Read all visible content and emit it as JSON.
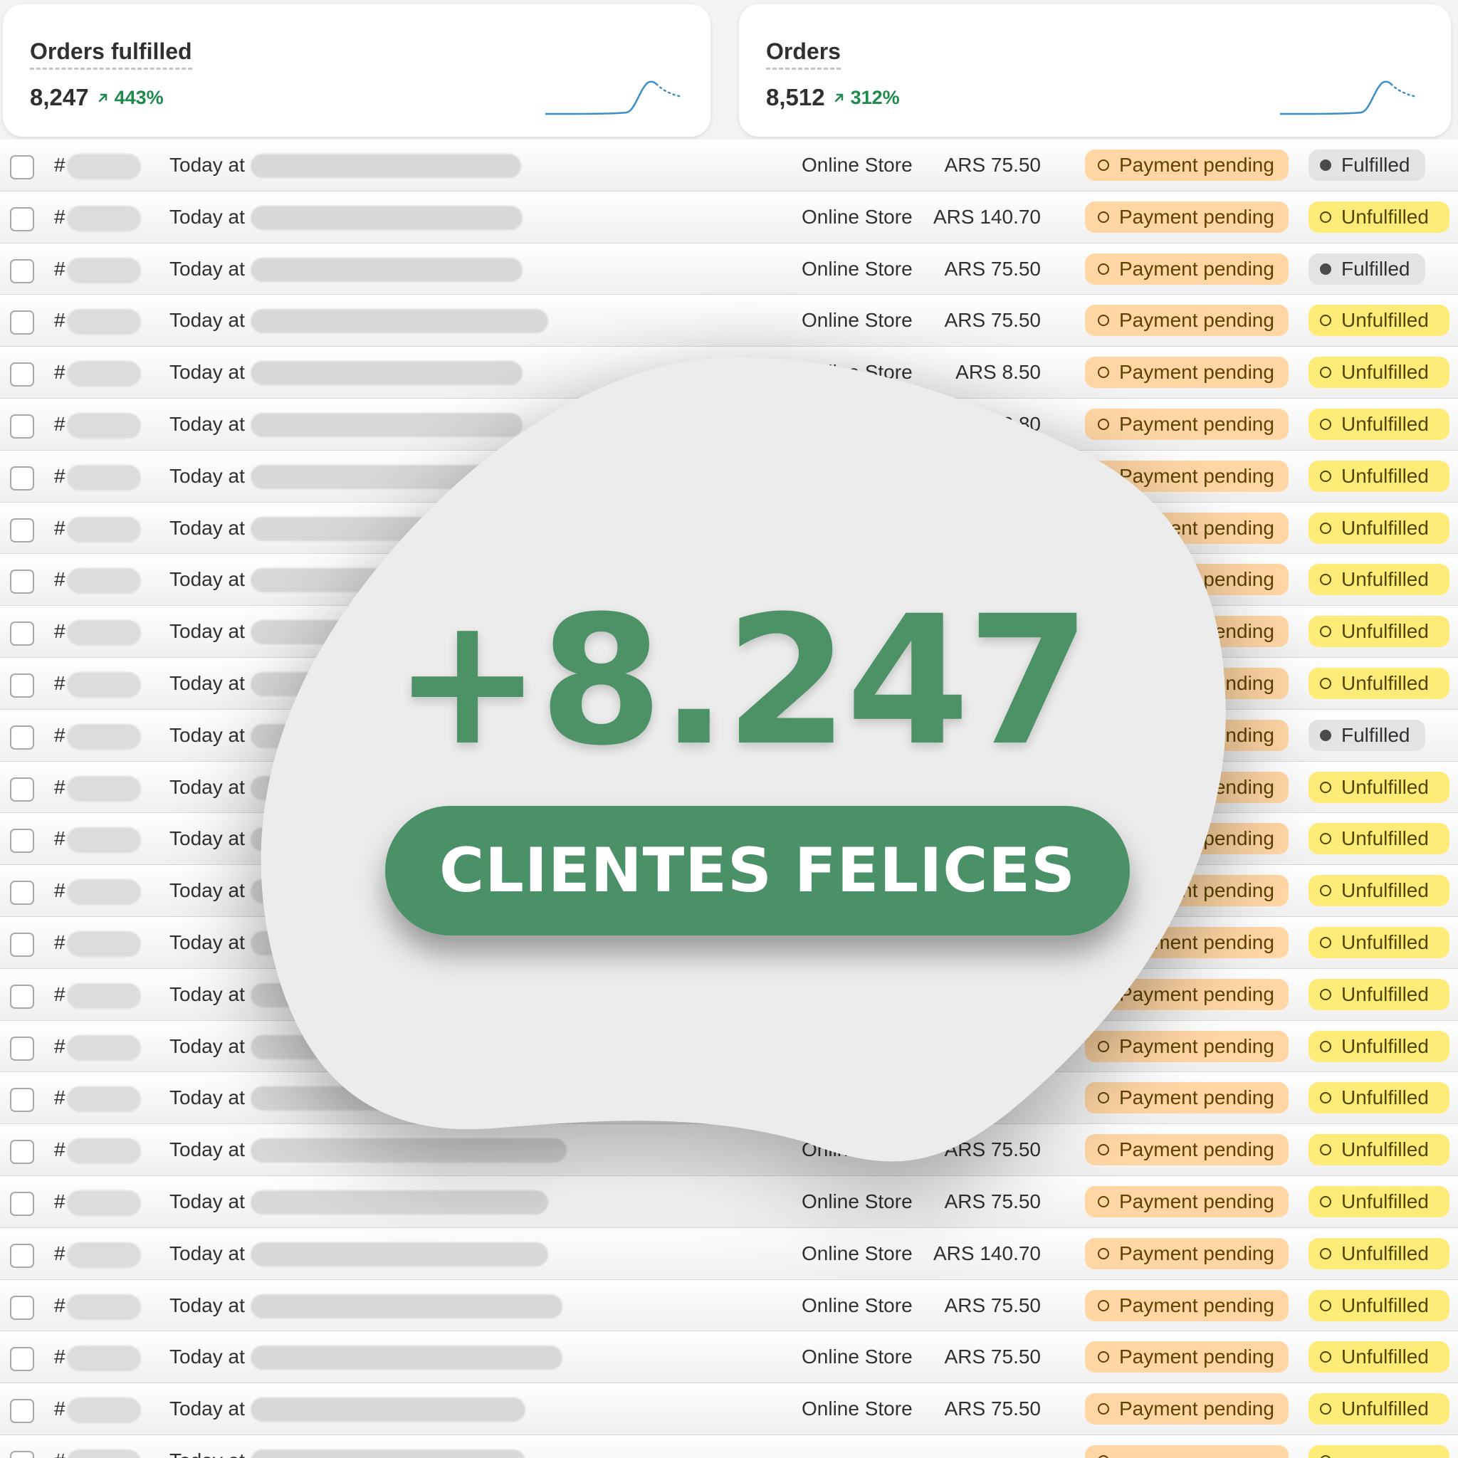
{
  "metrics": [
    {
      "title": "Orders fulfilled",
      "value": "8,247",
      "change": "443%",
      "trend_color": "#1f8a4c"
    },
    {
      "title": "Orders",
      "value": "8,512",
      "change": "312%",
      "trend_color": "#1f8a4c"
    }
  ],
  "table": {
    "rows": [
      {
        "hash": "#",
        "date": "Today at",
        "channel": "Online Store",
        "total": "ARS 75.50",
        "payment": "Payment pending",
        "fulfillment": "Fulfilled",
        "state": "fulfilled"
      },
      {
        "hash": "#",
        "date": "Today at",
        "channel": "Online Store",
        "total": "ARS 140.70",
        "payment": "Payment pending",
        "fulfillment": "Unfulfilled",
        "state": "unfulfilled"
      },
      {
        "hash": "#",
        "date": "Today at",
        "channel": "Online Store",
        "total": "ARS 75.50",
        "payment": "Payment pending",
        "fulfillment": "Fulfilled",
        "state": "fulfilled"
      },
      {
        "hash": "#",
        "date": "Today at",
        "channel": "Online Store",
        "total": "ARS 75.50",
        "payment": "Payment pending",
        "fulfillment": "Unfulfilled",
        "state": "unfulfilled"
      },
      {
        "hash": "#",
        "date": "Today at",
        "channel": "Online Store",
        "total": "ARS 8.50",
        "payment": "Payment pending",
        "fulfillment": "Unfulfilled",
        "state": "unfulfilled"
      },
      {
        "hash": "#",
        "date": "Today at",
        "channel": "Online Store",
        "total": "ARS 68.80",
        "payment": "Payment pending",
        "fulfillment": "Unfulfilled",
        "state": "unfulfilled"
      },
      {
        "hash": "#",
        "date": "Today at",
        "channel": "",
        "total": "",
        "payment": "Payment pending",
        "fulfillment": "Unfulfilled",
        "state": "unfulfilled"
      },
      {
        "hash": "#",
        "date": "Today at",
        "channel": "",
        "total": "",
        "payment": "Payment pending",
        "fulfillment": "Unfulfilled",
        "state": "unfulfilled"
      },
      {
        "hash": "#",
        "date": "Today at",
        "channel": "",
        "total": "",
        "payment": "Payment pending",
        "fulfillment": "Unfulfilled",
        "state": "unfulfilled"
      },
      {
        "hash": "#",
        "date": "Today at",
        "channel": "",
        "total": "",
        "payment": "Payment pending",
        "fulfillment": "Unfulfilled",
        "state": "unfulfilled"
      },
      {
        "hash": "#",
        "date": "Today at",
        "channel": "",
        "total": "",
        "payment": "Payment pending",
        "fulfillment": "Unfulfilled",
        "state": "unfulfilled"
      },
      {
        "hash": "#",
        "date": "Today at",
        "channel": "",
        "total": "",
        "payment": "Payment pending",
        "fulfillment": "Fulfilled",
        "state": "fulfilled"
      },
      {
        "hash": "#",
        "date": "Today at",
        "channel": "",
        "total": "",
        "payment": "Payment pending",
        "fulfillment": "Unfulfilled",
        "state": "unfulfilled"
      },
      {
        "hash": "#",
        "date": "Today at",
        "channel": "",
        "total": "",
        "payment": "Payment pending",
        "fulfillment": "Unfulfilled",
        "state": "unfulfilled"
      },
      {
        "hash": "#",
        "date": "Today at",
        "channel": "",
        "total": "",
        "payment": "Payment pending",
        "fulfillment": "Unfulfilled",
        "state": "unfulfilled"
      },
      {
        "hash": "#",
        "date": "Today at",
        "channel": "",
        "total": "",
        "payment": "Payment pending",
        "fulfillment": "Unfulfilled",
        "state": "unfulfilled"
      },
      {
        "hash": "#",
        "date": "Today at",
        "channel": "",
        "total": "",
        "payment": "Payment pending",
        "fulfillment": "Unfulfilled",
        "state": "unfulfilled"
      },
      {
        "hash": "#",
        "date": "Today at",
        "channel": "",
        "total": "",
        "payment": "Payment pending",
        "fulfillment": "Unfulfilled",
        "state": "unfulfilled"
      },
      {
        "hash": "#",
        "date": "Today at",
        "channel": "",
        "total": "",
        "payment": "Payment pending",
        "fulfillment": "Unfulfilled",
        "state": "unfulfilled"
      },
      {
        "hash": "#",
        "date": "Today at",
        "channel": "Online Store",
        "total": "ARS 75.50",
        "payment": "Payment pending",
        "fulfillment": "Unfulfilled",
        "state": "unfulfilled"
      },
      {
        "hash": "#",
        "date": "Today at",
        "channel": "Online Store",
        "total": "ARS 75.50",
        "payment": "Payment pending",
        "fulfillment": "Unfulfilled",
        "state": "unfulfilled"
      },
      {
        "hash": "#",
        "date": "Today at",
        "channel": "Online Store",
        "total": "ARS 140.70",
        "payment": "Payment pending",
        "fulfillment": "Unfulfilled",
        "state": "unfulfilled"
      },
      {
        "hash": "#",
        "date": "Today at",
        "channel": "Online Store",
        "total": "ARS 75.50",
        "payment": "Payment pending",
        "fulfillment": "Unfulfilled",
        "state": "unfulfilled"
      },
      {
        "hash": "#",
        "date": "Today at",
        "channel": "Online Store",
        "total": "ARS 75.50",
        "payment": "Payment pending",
        "fulfillment": "Unfulfilled",
        "state": "unfulfilled"
      },
      {
        "hash": "#",
        "date": "Today at",
        "channel": "Online Store",
        "total": "ARS 75.50",
        "payment": "Payment pending",
        "fulfillment": "Unfulfilled",
        "state": "unfulfilled"
      },
      {
        "hash": "#",
        "date": "Today at",
        "channel": "",
        "total": "",
        "payment": "",
        "fulfillment": "",
        "state": "unfulfilled"
      }
    ]
  },
  "promo": {
    "number": "+8.247",
    "tagline": "CLIENTES FELICES",
    "accent_color": "#4a9167"
  },
  "colors": {
    "payment_badge": "#ffd6a4",
    "unfulfilled_badge": "#ffeb78",
    "fulfilled_badge": "#e3e3e3"
  }
}
